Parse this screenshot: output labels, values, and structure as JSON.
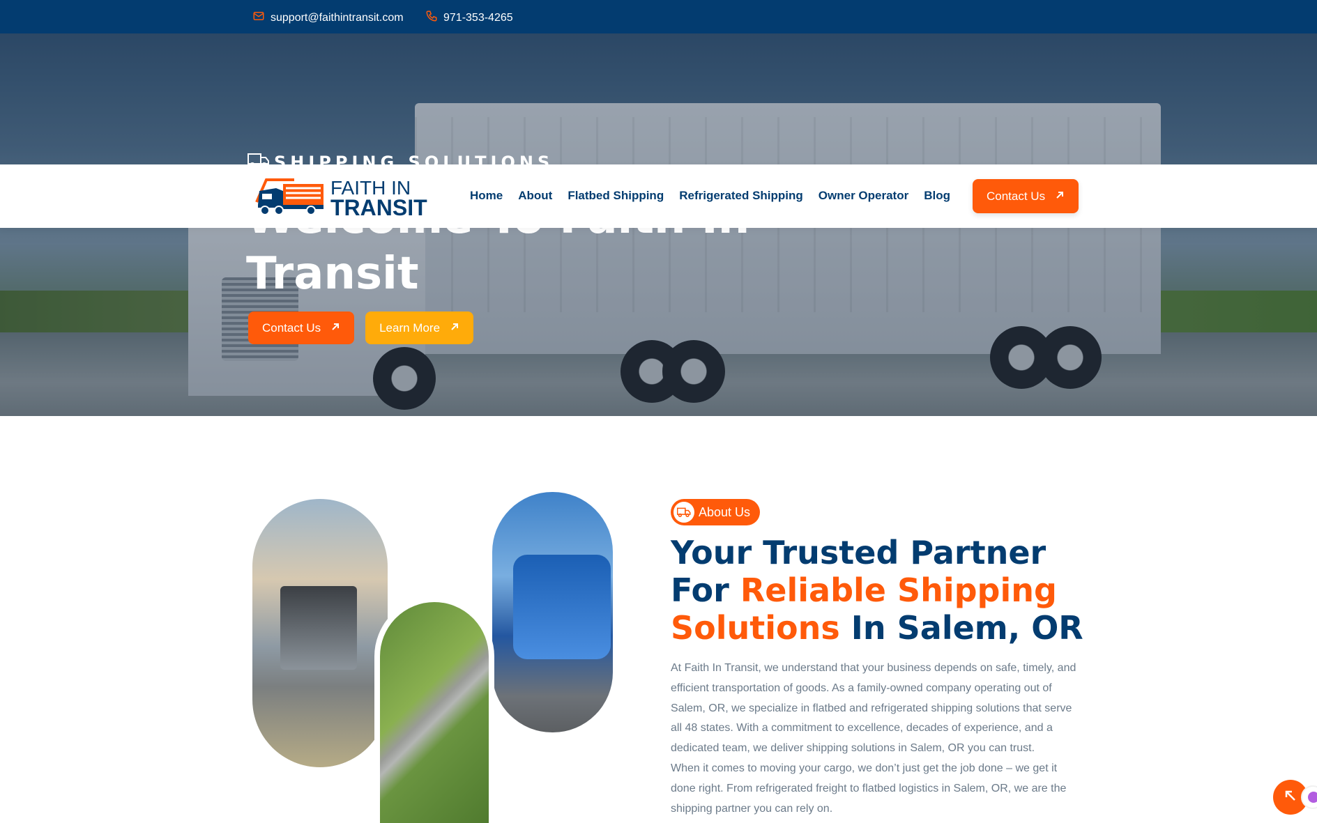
{
  "topbar": {
    "email": "support@faithintransit.com",
    "phone": "971-353-4265"
  },
  "hero": {
    "eyebrow": "SHIPPING SOLUTIONS",
    "title": "Welcome To Faith In Transit",
    "contact_label": "Contact Us",
    "learn_label": "Learn More"
  },
  "nav": {
    "logo_line1": "FAITH IN",
    "logo_line2": "TRANSIT",
    "items": [
      "Home",
      "About",
      "Flatbed Shipping",
      "Refrigerated Shipping",
      "Owner Operator",
      "Blog"
    ],
    "contact_label": "Contact Us"
  },
  "about": {
    "pill": "About Us",
    "title_1": "Your Trusted Partner For ",
    "title_highlight": "Reliable Shipping Solutions",
    "title_2": " In Salem, OR",
    "paragraph_1": "At Faith In Transit, we understand that your business depends on safe, timely, and efficient transportation of goods. As a family-owned company operating out of Salem, OR, we specialize in flatbed and refrigerated shipping solutions that serve all 48 states. With a commitment to excellence, decades of experience, and a dedicated team, we deliver shipping solutions in Salem, OR you can trust.",
    "paragraph_2": "When it comes to moving your cargo, we don’t just get the job done – we get it done right. From refrigerated freight to flatbed logistics in Salem, OR, we are the shipping partner you can rely on."
  },
  "colors": {
    "navy": "#033c70",
    "orange": "#ff5a0a",
    "yellow": "#ffab0a",
    "body_text": "#6b7a89"
  },
  "icons": [
    "mail-icon",
    "phone-icon",
    "truck-icon",
    "arrow-up-right-icon",
    "scroll-top-icon"
  ]
}
